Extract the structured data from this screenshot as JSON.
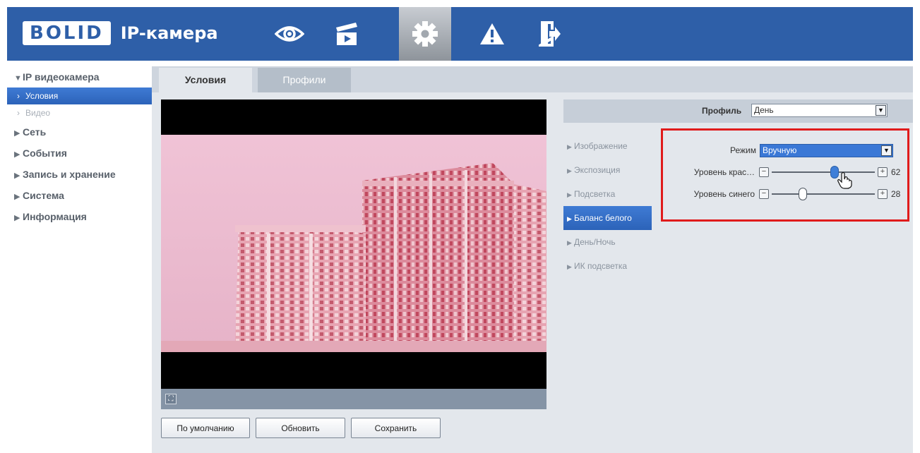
{
  "header": {
    "logo_badge": "BOLID",
    "logo_text": "IP-камера",
    "nav": [
      {
        "name": "live-view",
        "icon": "eye-icon",
        "active": false
      },
      {
        "name": "playback",
        "icon": "clapperboard-icon",
        "active": false
      },
      {
        "name": "settings",
        "icon": "gear-icon",
        "active": true
      },
      {
        "name": "alarm",
        "icon": "warning-icon",
        "active": false
      },
      {
        "name": "logout",
        "icon": "exit-icon",
        "active": false
      }
    ]
  },
  "sidebar": {
    "camera": "IP видеокамера",
    "conditions": "Условия",
    "video": "Видео",
    "network": "Сеть",
    "events": "События",
    "storage": "Запись и хранение",
    "system": "Система",
    "info": "Информация"
  },
  "tabs": {
    "conditions": "Условия",
    "profiles": "Профили"
  },
  "buttons": {
    "default": "По умолчанию",
    "refresh": "Обновить",
    "save": "Сохранить"
  },
  "profile": {
    "label": "Профиль",
    "value": "День"
  },
  "categories": {
    "image": "Изображение",
    "exposure": "Экспозиция",
    "backlight": "Подсветка",
    "white_balance": "Баланс белого",
    "day_night": "День/Ночь",
    "ir": "ИК подсветка"
  },
  "white_balance": {
    "mode_label": "Режим",
    "mode_value": "Вручную",
    "red_label": "Уровень крас…",
    "red_value": 62,
    "blue_label": "Уровень синего",
    "blue_value": 28
  },
  "colors": {
    "header": "#2e5fa8",
    "active": "#3f7bd4",
    "highlight_frame": "#e01b1b"
  }
}
